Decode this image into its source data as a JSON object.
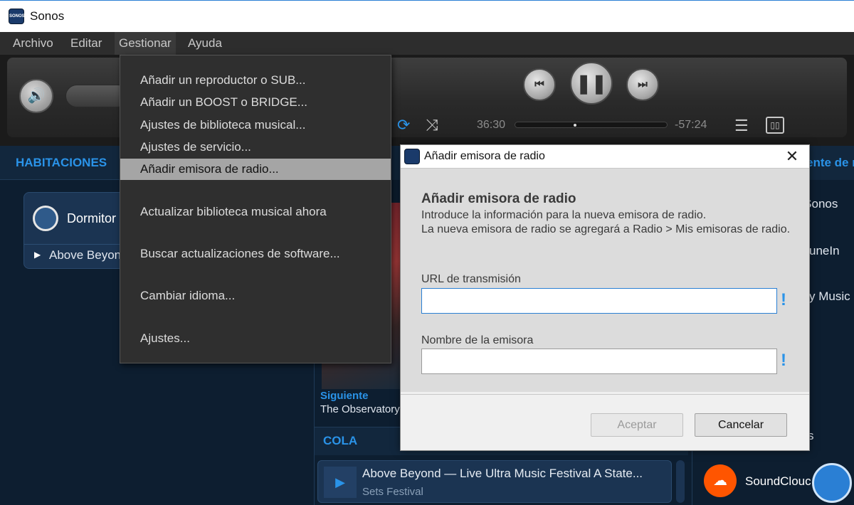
{
  "window": {
    "title": "Sonos",
    "icon": "sonos-icon"
  },
  "menubar": {
    "items": [
      "Archivo",
      "Editar",
      "Gestionar",
      "Ayuda"
    ],
    "active": "Gestionar"
  },
  "transport": {
    "time_elapsed": "36:30",
    "time_remaining": "-57:24",
    "progress_fraction": 0.39,
    "icons": [
      "volume-icon",
      "previous-icon",
      "pause-icon",
      "next-icon",
      "repeat-icon",
      "shuffle-icon",
      "equalizer-icon",
      "group-icon"
    ]
  },
  "rooms": {
    "header": "HABITACIONES",
    "room_name": "Dormitor",
    "now_playing": "Above  Beyon"
  },
  "now_playing": {
    "next_label": "Siguiente",
    "next_track": "The Observatory",
    "queue_header": "COLA",
    "queue_track": "Above  Beyond — Live  Ultra Music Festival A State...",
    "queue_sub": "Sets Festival"
  },
  "music": {
    "header": "ente de m",
    "items": [
      "e Sonos",
      "uneIn",
      "y Music",
      "s"
    ],
    "soundcloud": "SoundClouc"
  },
  "dropdown": {
    "items": [
      "Añadir un reproductor o SUB...",
      "Añadir un BOOST o BRIDGE...",
      "Ajustes de biblioteca musical...",
      "Ajustes de servicio...",
      "Añadir emisora de radio...",
      "Actualizar biblioteca musical ahora",
      "Buscar actualizaciones de software...",
      "Cambiar idioma...",
      "Ajustes..."
    ],
    "highlighted_index": 4
  },
  "dialog": {
    "title": "Añadir emisora de radio",
    "heading": "Añadir emisora de radio",
    "description_1": "Introduce la información para la nueva emisora de radio.",
    "description_2": "La nueva emisora de radio se agregará a Radio > Mis emisoras de radio.",
    "url_label": "URL de transmisión",
    "url_value": "",
    "name_label": "Nombre de la emisora",
    "name_value": "",
    "required_marker": "!",
    "ok_label": "Aceptar",
    "cancel_label": "Cancelar",
    "close_glyph": "✕"
  }
}
